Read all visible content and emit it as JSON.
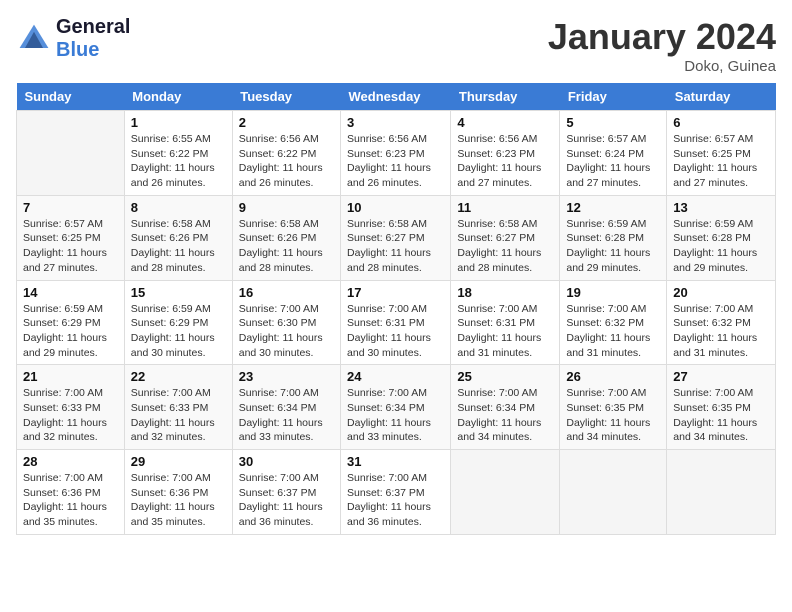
{
  "logo": {
    "line1": "General",
    "line2": "Blue"
  },
  "title": "January 2024",
  "location": "Doko, Guinea",
  "days_of_week": [
    "Sunday",
    "Monday",
    "Tuesday",
    "Wednesday",
    "Thursday",
    "Friday",
    "Saturday"
  ],
  "weeks": [
    [
      {
        "day": "",
        "info": ""
      },
      {
        "day": "1",
        "info": "Sunrise: 6:55 AM\nSunset: 6:22 PM\nDaylight: 11 hours\nand 26 minutes."
      },
      {
        "day": "2",
        "info": "Sunrise: 6:56 AM\nSunset: 6:22 PM\nDaylight: 11 hours\nand 26 minutes."
      },
      {
        "day": "3",
        "info": "Sunrise: 6:56 AM\nSunset: 6:23 PM\nDaylight: 11 hours\nand 26 minutes."
      },
      {
        "day": "4",
        "info": "Sunrise: 6:56 AM\nSunset: 6:23 PM\nDaylight: 11 hours\nand 27 minutes."
      },
      {
        "day": "5",
        "info": "Sunrise: 6:57 AM\nSunset: 6:24 PM\nDaylight: 11 hours\nand 27 minutes."
      },
      {
        "day": "6",
        "info": "Sunrise: 6:57 AM\nSunset: 6:25 PM\nDaylight: 11 hours\nand 27 minutes."
      }
    ],
    [
      {
        "day": "7",
        "info": "Sunrise: 6:57 AM\nSunset: 6:25 PM\nDaylight: 11 hours\nand 27 minutes."
      },
      {
        "day": "8",
        "info": "Sunrise: 6:58 AM\nSunset: 6:26 PM\nDaylight: 11 hours\nand 28 minutes."
      },
      {
        "day": "9",
        "info": "Sunrise: 6:58 AM\nSunset: 6:26 PM\nDaylight: 11 hours\nand 28 minutes."
      },
      {
        "day": "10",
        "info": "Sunrise: 6:58 AM\nSunset: 6:27 PM\nDaylight: 11 hours\nand 28 minutes."
      },
      {
        "day": "11",
        "info": "Sunrise: 6:58 AM\nSunset: 6:27 PM\nDaylight: 11 hours\nand 28 minutes."
      },
      {
        "day": "12",
        "info": "Sunrise: 6:59 AM\nSunset: 6:28 PM\nDaylight: 11 hours\nand 29 minutes."
      },
      {
        "day": "13",
        "info": "Sunrise: 6:59 AM\nSunset: 6:28 PM\nDaylight: 11 hours\nand 29 minutes."
      }
    ],
    [
      {
        "day": "14",
        "info": "Sunrise: 6:59 AM\nSunset: 6:29 PM\nDaylight: 11 hours\nand 29 minutes."
      },
      {
        "day": "15",
        "info": "Sunrise: 6:59 AM\nSunset: 6:29 PM\nDaylight: 11 hours\nand 30 minutes."
      },
      {
        "day": "16",
        "info": "Sunrise: 7:00 AM\nSunset: 6:30 PM\nDaylight: 11 hours\nand 30 minutes."
      },
      {
        "day": "17",
        "info": "Sunrise: 7:00 AM\nSunset: 6:31 PM\nDaylight: 11 hours\nand 30 minutes."
      },
      {
        "day": "18",
        "info": "Sunrise: 7:00 AM\nSunset: 6:31 PM\nDaylight: 11 hours\nand 31 minutes."
      },
      {
        "day": "19",
        "info": "Sunrise: 7:00 AM\nSunset: 6:32 PM\nDaylight: 11 hours\nand 31 minutes."
      },
      {
        "day": "20",
        "info": "Sunrise: 7:00 AM\nSunset: 6:32 PM\nDaylight: 11 hours\nand 31 minutes."
      }
    ],
    [
      {
        "day": "21",
        "info": "Sunrise: 7:00 AM\nSunset: 6:33 PM\nDaylight: 11 hours\nand 32 minutes."
      },
      {
        "day": "22",
        "info": "Sunrise: 7:00 AM\nSunset: 6:33 PM\nDaylight: 11 hours\nand 32 minutes."
      },
      {
        "day": "23",
        "info": "Sunrise: 7:00 AM\nSunset: 6:34 PM\nDaylight: 11 hours\nand 33 minutes."
      },
      {
        "day": "24",
        "info": "Sunrise: 7:00 AM\nSunset: 6:34 PM\nDaylight: 11 hours\nand 33 minutes."
      },
      {
        "day": "25",
        "info": "Sunrise: 7:00 AM\nSunset: 6:34 PM\nDaylight: 11 hours\nand 34 minutes."
      },
      {
        "day": "26",
        "info": "Sunrise: 7:00 AM\nSunset: 6:35 PM\nDaylight: 11 hours\nand 34 minutes."
      },
      {
        "day": "27",
        "info": "Sunrise: 7:00 AM\nSunset: 6:35 PM\nDaylight: 11 hours\nand 34 minutes."
      }
    ],
    [
      {
        "day": "28",
        "info": "Sunrise: 7:00 AM\nSunset: 6:36 PM\nDaylight: 11 hours\nand 35 minutes."
      },
      {
        "day": "29",
        "info": "Sunrise: 7:00 AM\nSunset: 6:36 PM\nDaylight: 11 hours\nand 35 minutes."
      },
      {
        "day": "30",
        "info": "Sunrise: 7:00 AM\nSunset: 6:37 PM\nDaylight: 11 hours\nand 36 minutes."
      },
      {
        "day": "31",
        "info": "Sunrise: 7:00 AM\nSunset: 6:37 PM\nDaylight: 11 hours\nand 36 minutes."
      },
      {
        "day": "",
        "info": ""
      },
      {
        "day": "",
        "info": ""
      },
      {
        "day": "",
        "info": ""
      }
    ]
  ]
}
